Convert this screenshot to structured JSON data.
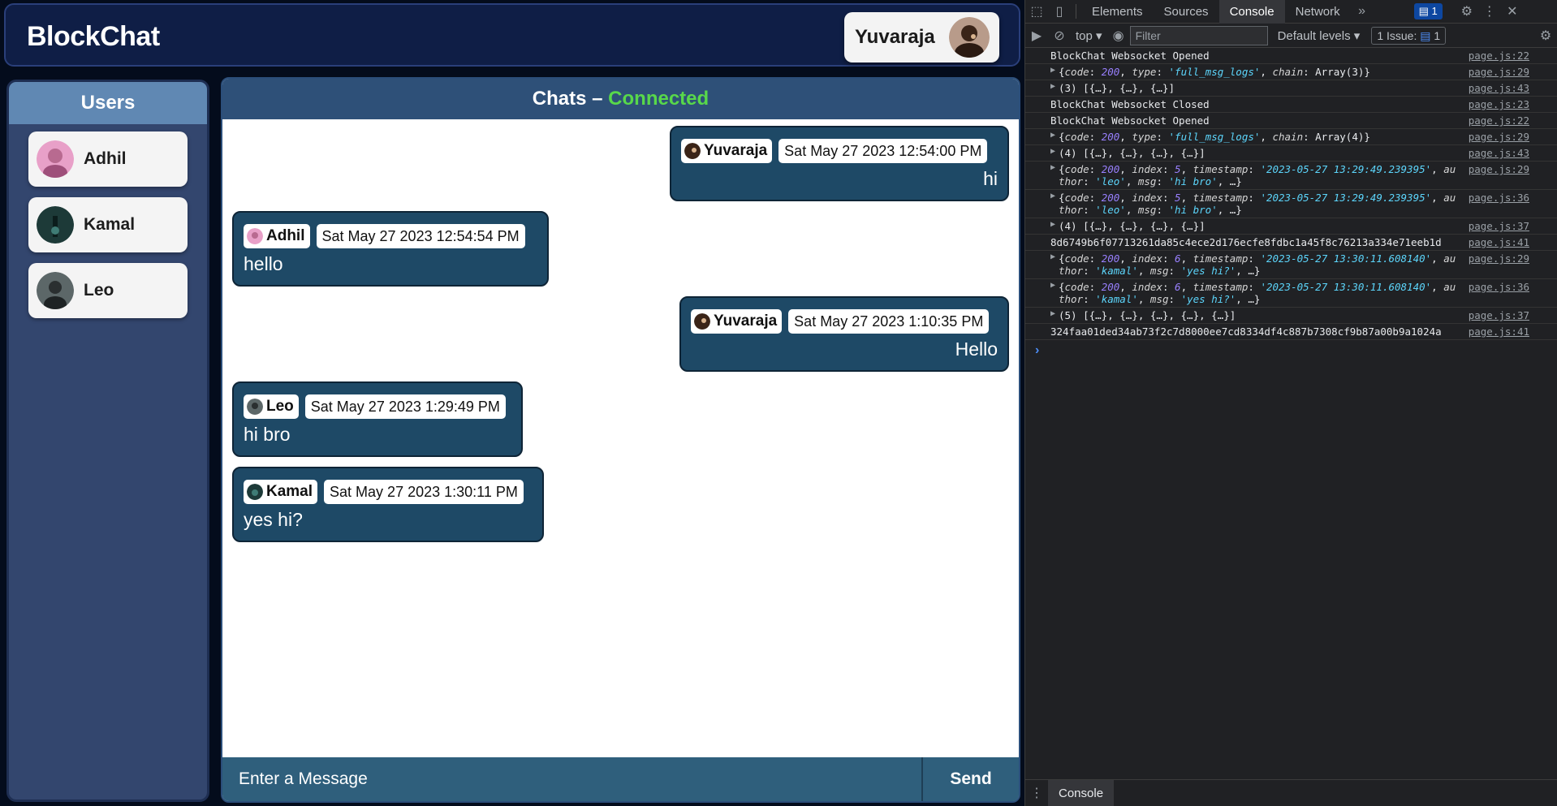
{
  "app": {
    "brand": "BlockChat",
    "user": {
      "name": "Yuvaraja"
    },
    "users_panel": {
      "title": "Users",
      "users": [
        {
          "name": "Adhil"
        },
        {
          "name": "Kamal"
        },
        {
          "name": "Leo"
        }
      ]
    },
    "chat": {
      "title_prefix": "Chats – ",
      "status": "Connected",
      "messages": [
        {
          "author": "Yuvaraja",
          "time": "Sat May 27 2023 12:54:00 PM",
          "text": "hi",
          "own": true
        },
        {
          "author": "Adhil",
          "time": "Sat May 27 2023 12:54:54 PM",
          "text": "hello",
          "own": false
        },
        {
          "author": "Yuvaraja",
          "time": "Sat May 27 2023 1:10:35 PM",
          "text": "Hello",
          "own": true
        },
        {
          "author": "Leo",
          "time": "Sat May 27 2023 1:29:49 PM",
          "text": "hi bro",
          "own": false
        },
        {
          "author": "Kamal",
          "time": "Sat May 27 2023 1:30:11 PM",
          "text": "yes hi?",
          "own": false
        }
      ],
      "composer_placeholder": "Enter a Message",
      "send_label": "Send"
    },
    "colors": {
      "accent": "#58d84a",
      "header_bg": "#0f1e46",
      "bubble_bg": "#1e4966"
    }
  },
  "devtools": {
    "tabs": [
      "Elements",
      "Sources",
      "Console",
      "Network"
    ],
    "active_tab": "Console",
    "messages_badge": "1",
    "context": "top",
    "filter_placeholder": "Filter",
    "levels": "Default levels",
    "issues": "1 Issue:",
    "issues_count": "1",
    "drawer_tab": "Console",
    "logs": [
      {
        "text": "BlockChat Websocket Opened",
        "src": "page.js:22"
      },
      {
        "text": "{code: 200, type: 'full_msg_logs', chain: Array(3)}",
        "src": "page.js:29",
        "expand": true
      },
      {
        "text": "(3) [{…}, {…}, {…}]",
        "src": "page.js:43",
        "expand": true
      },
      {
        "text": "BlockChat Websocket Closed",
        "src": "page.js:23"
      },
      {
        "text": "BlockChat Websocket Opened",
        "src": "page.js:22"
      },
      {
        "text": "{code: 200, type: 'full_msg_logs', chain: Array(4)}",
        "src": "page.js:29",
        "expand": true
      },
      {
        "text": "(4) [{…}, {…}, {…}, {…}]",
        "src": "page.js:43",
        "expand": true
      },
      {
        "text": "{code: 200, index: 5, timestamp: '2023-05-27 13:29:49.239395', author: 'leo', msg: 'hi bro', …}",
        "src": "page.js:29",
        "expand": true
      },
      {
        "text": "{code: 200, index: 5, timestamp: '2023-05-27 13:29:49.239395', author: 'leo', msg: 'hi bro', …}",
        "src": "page.js:36",
        "expand": true
      },
      {
        "text": "(4) [{…}, {…}, {…}, {…}]",
        "src": "page.js:37",
        "expand": true
      },
      {
        "text": "8d6749b6f07713261da85c4ece2d176ecfe8fdbc1a45f8c76213a334e71eeb1d",
        "src": "page.js:41"
      },
      {
        "text": "{code: 200, index: 6, timestamp: '2023-05-27 13:30:11.608140', author: 'kamal', msg: 'yes hi?', …}",
        "src": "page.js:29",
        "expand": true
      },
      {
        "text": "{code: 200, index: 6, timestamp: '2023-05-27 13:30:11.608140', author: 'kamal', msg: 'yes hi?', …}",
        "src": "page.js:36",
        "expand": true
      },
      {
        "text": "(5) [{…}, {…}, {…}, {…}, {…}]",
        "src": "page.js:37",
        "expand": true
      },
      {
        "text": "324faa01ded34ab73f2c7d8000ee7cd8334df4c887b7308cf9b87a00b9a1024a",
        "src": "page.js:41"
      }
    ]
  }
}
